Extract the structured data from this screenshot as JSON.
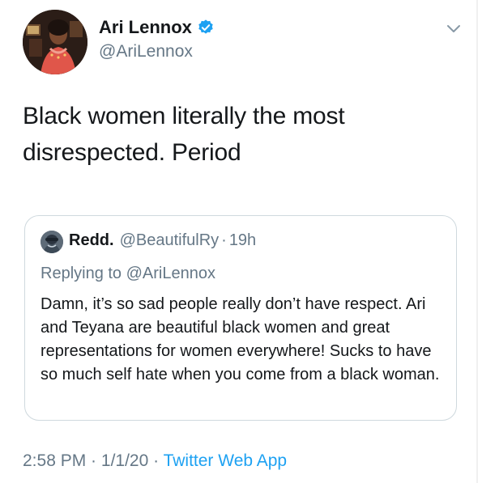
{
  "author": {
    "display_name": "Ari Lennox",
    "handle": "@AriLennox",
    "verified": true
  },
  "tweet": {
    "text": "Black women literally the most disrespected. Period"
  },
  "quoted_tweet": {
    "display_name": "Redd.",
    "handle": "@BeautifulRy",
    "separator": "·",
    "time": "19h",
    "replying_prefix": "Replying to ",
    "replying_to": "@AriLennox",
    "text": "Damn, it’s so sad people really don’t have respect. Ari and Teyana are beautiful black women and great representations for women everywhere! Sucks to have so much self hate when you come from a black woman."
  },
  "meta": {
    "time": "2:58 PM",
    "separator": " · ",
    "date": "1/1/20",
    "source": "Twitter Web App"
  },
  "icons": {
    "verified": "verified-badge-icon",
    "menu": "chevron-down-icon"
  },
  "colors": {
    "accent": "#1da1f2",
    "secondary_text": "#657786",
    "primary_text": "#14171a",
    "border": "#cfd9de"
  }
}
